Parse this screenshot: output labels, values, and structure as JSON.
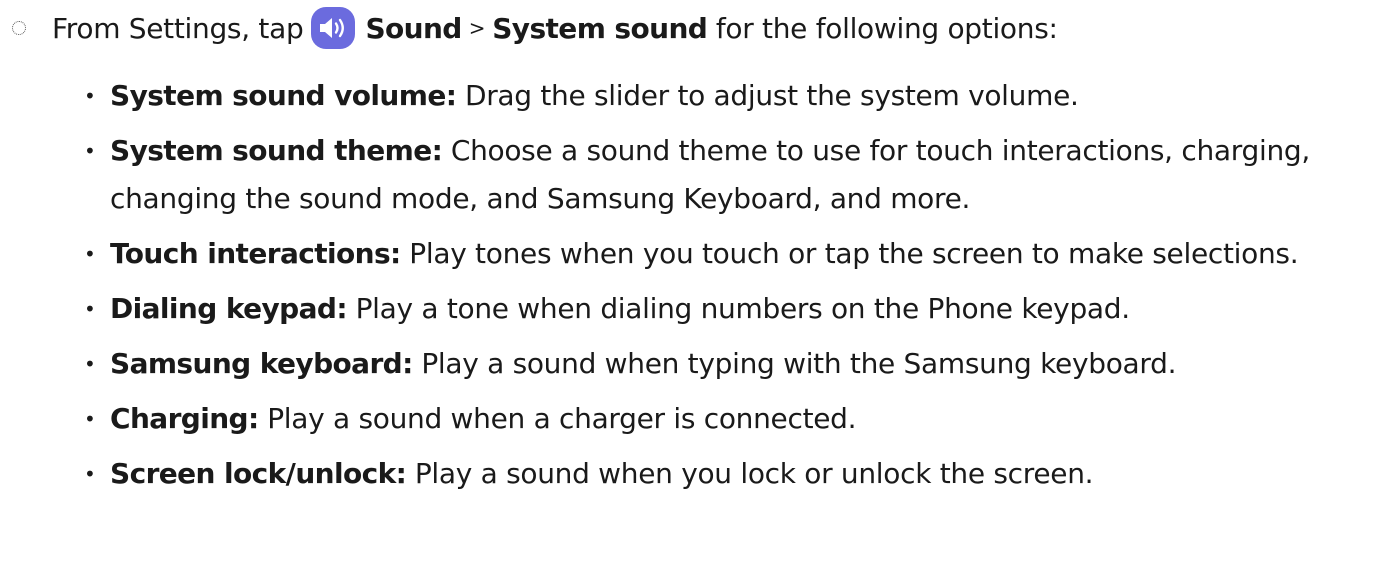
{
  "intro": {
    "prefix": "From Settings, tap",
    "icon": "sound-settings-icon",
    "icon_color": "#6b6bde",
    "menu_1": "Sound",
    "separator": ">",
    "menu_2": "System sound",
    "suffix": "for the following options:"
  },
  "options": [
    {
      "title": "System sound volume:",
      "text": "Drag the slider to adjust the system volume."
    },
    {
      "title": "System sound theme:",
      "text": "Choose a sound theme to use for touch interactions, charging, changing the sound mode, and Samsung Keyboard, and more."
    },
    {
      "title": "Touch interactions:",
      "text": "Play tones when you touch or tap the screen to make selections."
    },
    {
      "title": "Dialing keypad:",
      "text": "Play a tone when dialing numbers on the Phone keypad."
    },
    {
      "title": "Samsung keyboard:",
      "text": "Play a sound when typing with the Samsung keyboard."
    },
    {
      "title": "Charging:",
      "text": "Play a sound when a charger is connected."
    },
    {
      "title": "Screen lock/unlock:",
      "text": "Play a sound when you lock or unlock the screen."
    }
  ]
}
